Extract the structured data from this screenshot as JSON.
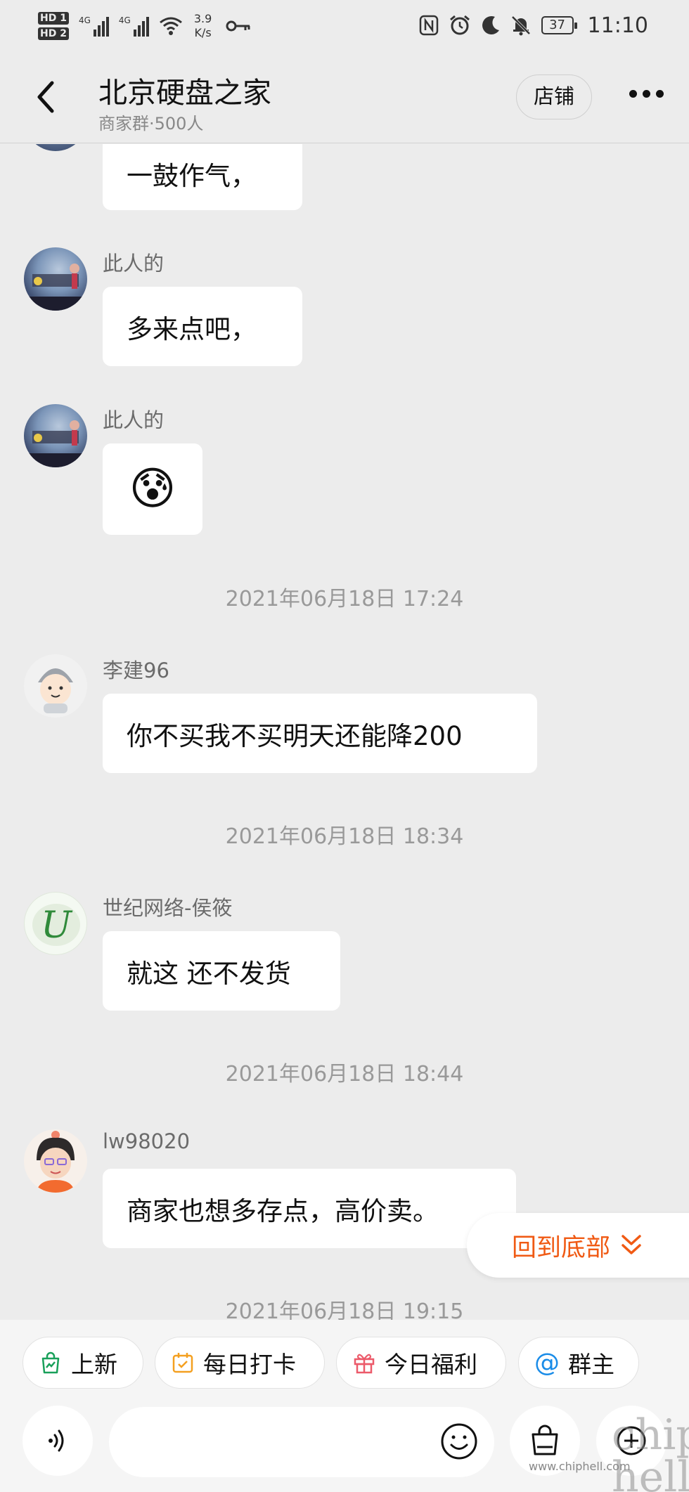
{
  "status_bar": {
    "sim1": "HD 1",
    "sim2": "HD 2",
    "net1": "4G",
    "net2": "4G",
    "speed_value": "3.9",
    "speed_unit": "K/s",
    "battery": "37",
    "time": "11:10"
  },
  "header": {
    "title": "北京硬盘之家",
    "subtitle": "商家群·500人",
    "shop_label": "店铺"
  },
  "messages": [
    {
      "sender": "",
      "text": "一鼓作气，"
    },
    {
      "sender": "此人的",
      "text": "多来点吧，"
    },
    {
      "sender": "此人的",
      "text": "😰"
    },
    {
      "stamp": "2021年06月18日 17:24"
    },
    {
      "sender": "李建96",
      "text": "你不买我不买明天还能降200"
    },
    {
      "stamp": "2021年06月18日 18:34"
    },
    {
      "sender": "世纪网络-侯筱",
      "text": "就这 还不发货"
    },
    {
      "stamp": "2021年06月18日 18:44"
    },
    {
      "sender": "lw98020",
      "text": "商家也想多存点，高价卖。"
    },
    {
      "stamp": "2021年06月18日 19:15"
    }
  ],
  "scroll_to_bottom": "回到底部",
  "quick_actions": [
    "上新",
    "每日打卡",
    "今日福利",
    "群主"
  ],
  "input": {
    "placeholder": ""
  },
  "watermark": {
    "logo": "chip hell",
    "url": "www.chiphell.com"
  },
  "colors": {
    "accent": "#f05a14",
    "bubble": "#ffffff",
    "background": "#ececec"
  },
  "icons": {
    "back": "chevron-left-icon",
    "more": "more-dots-icon",
    "voice": "voice-icon",
    "emoji": "smile-icon",
    "shop": "shopping-bag-icon",
    "plus": "plus-icon"
  }
}
